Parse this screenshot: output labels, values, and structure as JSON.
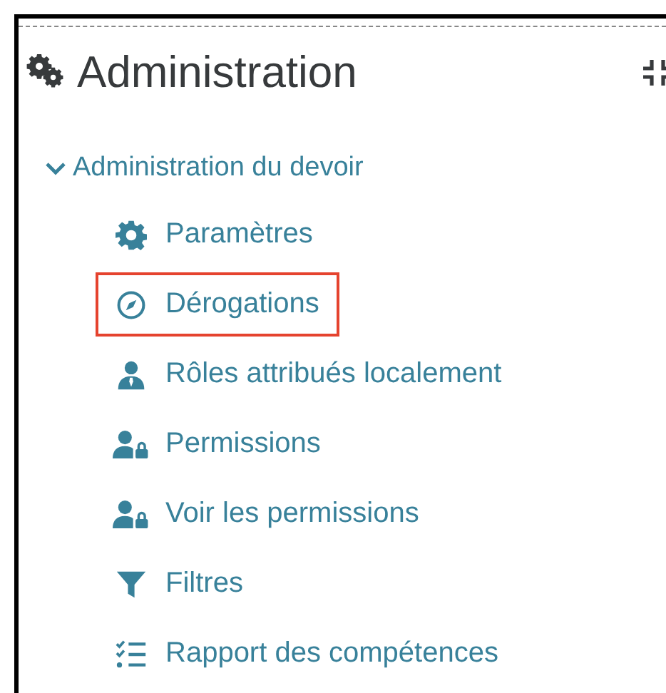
{
  "block": {
    "title": "Administration"
  },
  "section": {
    "label": "Administration du devoir",
    "expanded": true,
    "items": [
      {
        "kind": "settings",
        "label": "Paramètres",
        "highlighted": false
      },
      {
        "kind": "compass",
        "label": "Dérogations",
        "highlighted": true
      },
      {
        "kind": "user",
        "label": "Rôles attribués localement",
        "highlighted": false
      },
      {
        "kind": "user-lock",
        "label": "Permissions",
        "highlighted": false
      },
      {
        "kind": "user-lock",
        "label": "Voir les permissions",
        "highlighted": false
      },
      {
        "kind": "filter",
        "label": "Filtres",
        "highlighted": false
      },
      {
        "kind": "checklist",
        "label": "Rapport des compétences",
        "highlighted": false
      }
    ]
  }
}
